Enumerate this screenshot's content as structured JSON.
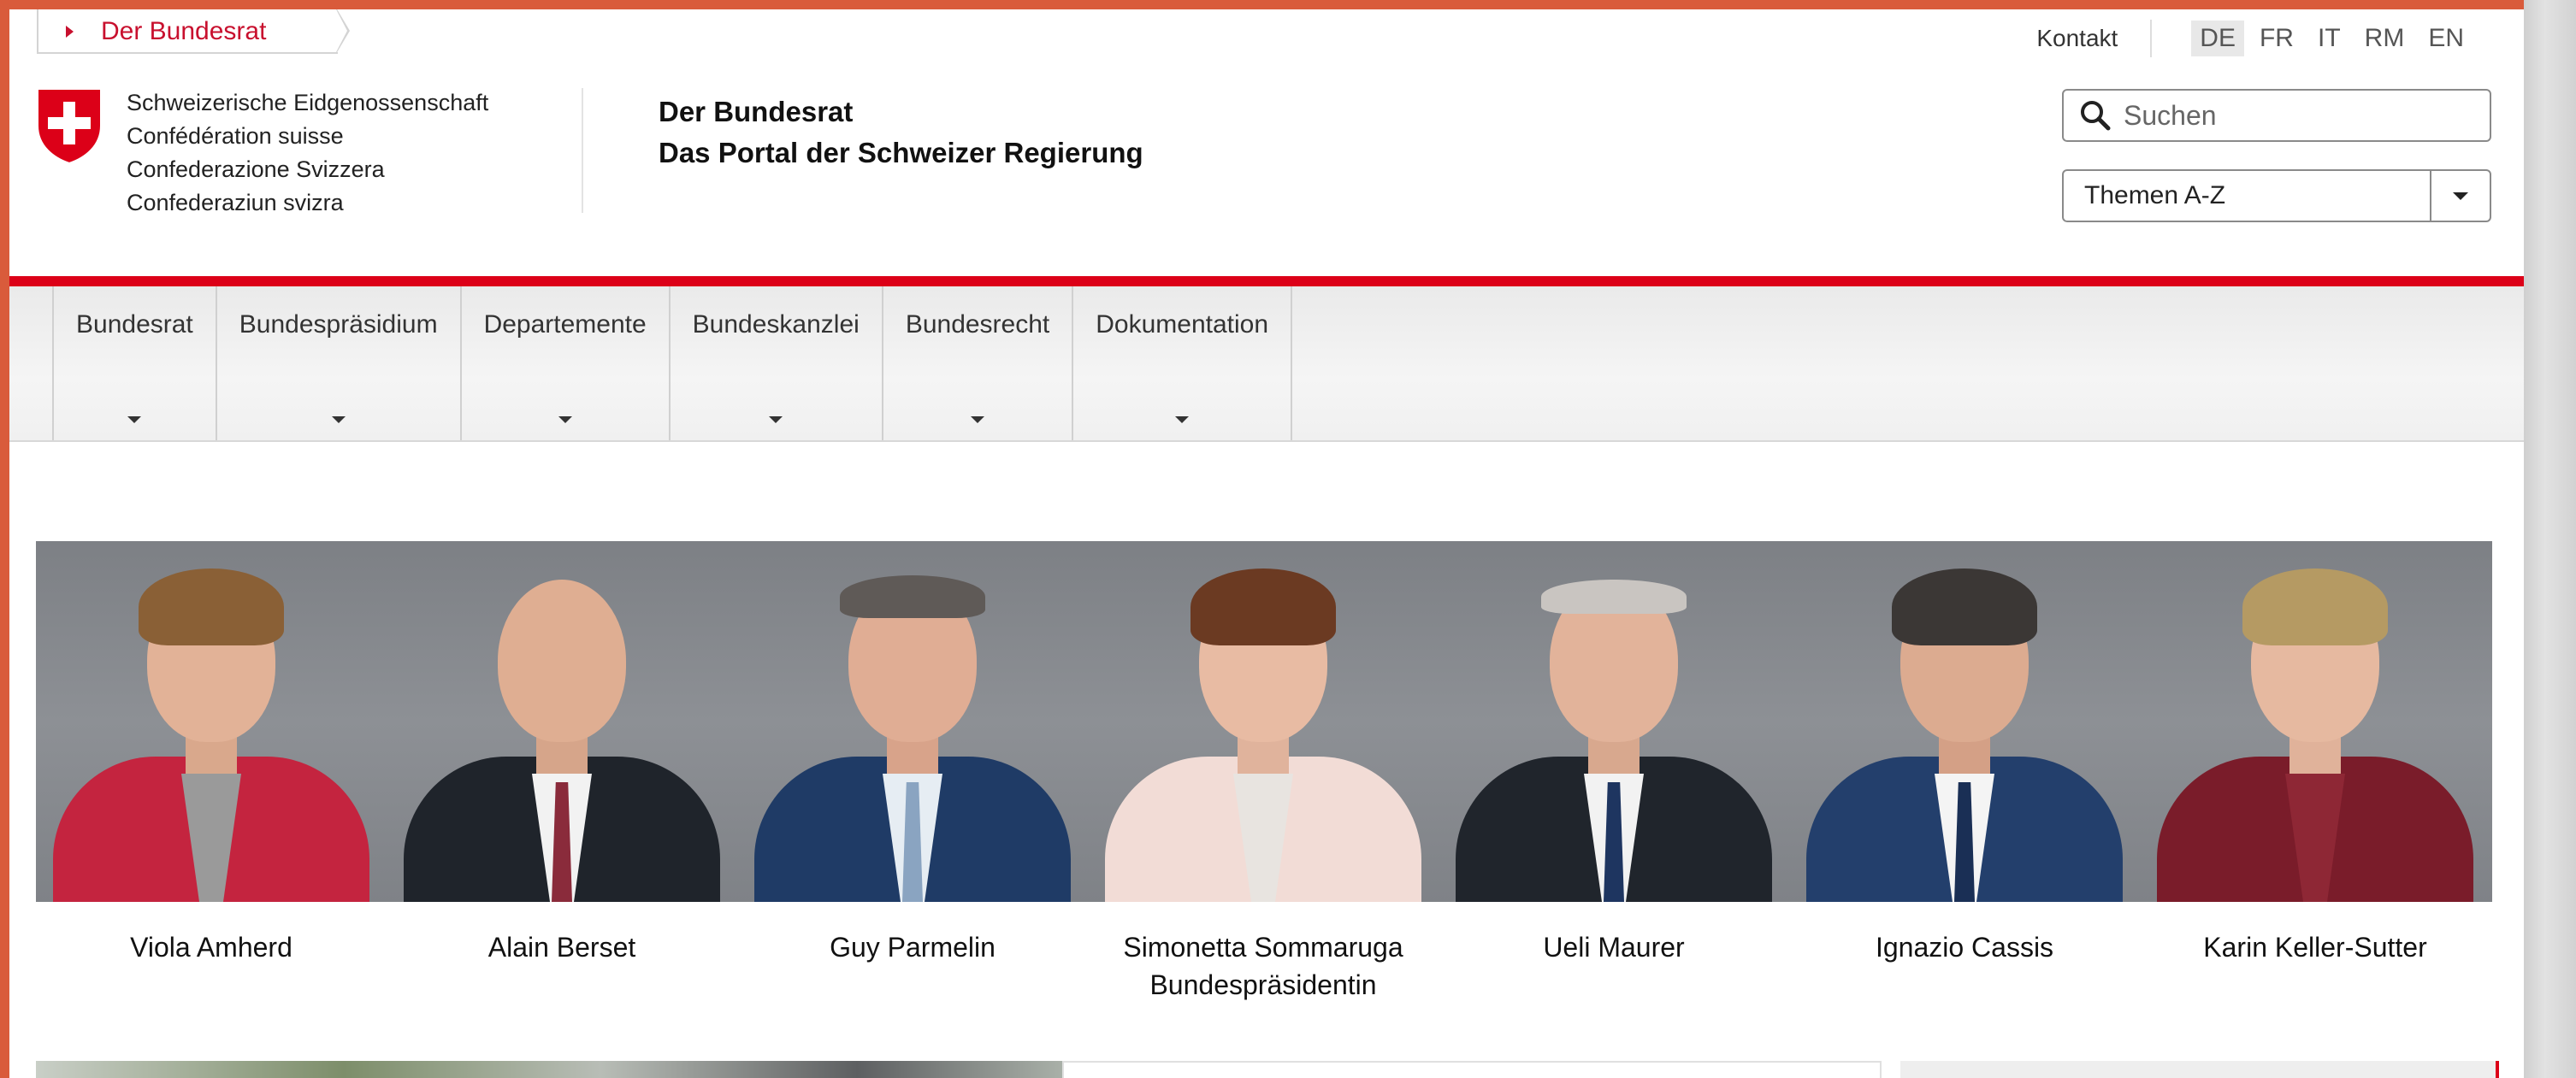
{
  "breadcrumb": {
    "label": "Der Bundesrat"
  },
  "meta_nav": {
    "kontakt": "Kontakt",
    "languages": [
      {
        "code": "DE",
        "active": true
      },
      {
        "code": "FR",
        "active": false
      },
      {
        "code": "IT",
        "active": false
      },
      {
        "code": "RM",
        "active": false
      },
      {
        "code": "EN",
        "active": false
      }
    ]
  },
  "header": {
    "confederation_names": [
      "Schweizerische Eidgenossenschaft",
      "Confédération suisse",
      "Confederazione Svizzera",
      "Confederaziun svizra"
    ],
    "portal_title": "Der Bundesrat",
    "portal_subtitle": "Das Portal der Schweizer Regierung"
  },
  "search": {
    "placeholder": "Suchen"
  },
  "topics_select": {
    "value": "Themen A-Z"
  },
  "main_nav": [
    {
      "label": "Bundesrat"
    },
    {
      "label": "Bundespräsidium"
    },
    {
      "label": "Departemente"
    },
    {
      "label": "Bundeskanzlei"
    },
    {
      "label": "Bundesrecht"
    },
    {
      "label": "Dokumentation"
    }
  ],
  "members": [
    {
      "name": "Viola Amherd",
      "role": ""
    },
    {
      "name": "Alain Berset",
      "role": ""
    },
    {
      "name": "Guy Parmelin",
      "role": ""
    },
    {
      "name": "Simonetta Sommaruga",
      "role": "Bundespräsidentin"
    },
    {
      "name": "Ueli Maurer",
      "role": ""
    },
    {
      "name": "Ignazio Cassis",
      "role": ""
    },
    {
      "name": "Karin Keller-Sutter",
      "role": ""
    }
  ],
  "colors": {
    "brand_red": "#dc0018",
    "link_red": "#c8102e",
    "frame_orange": "#d95b3b"
  }
}
